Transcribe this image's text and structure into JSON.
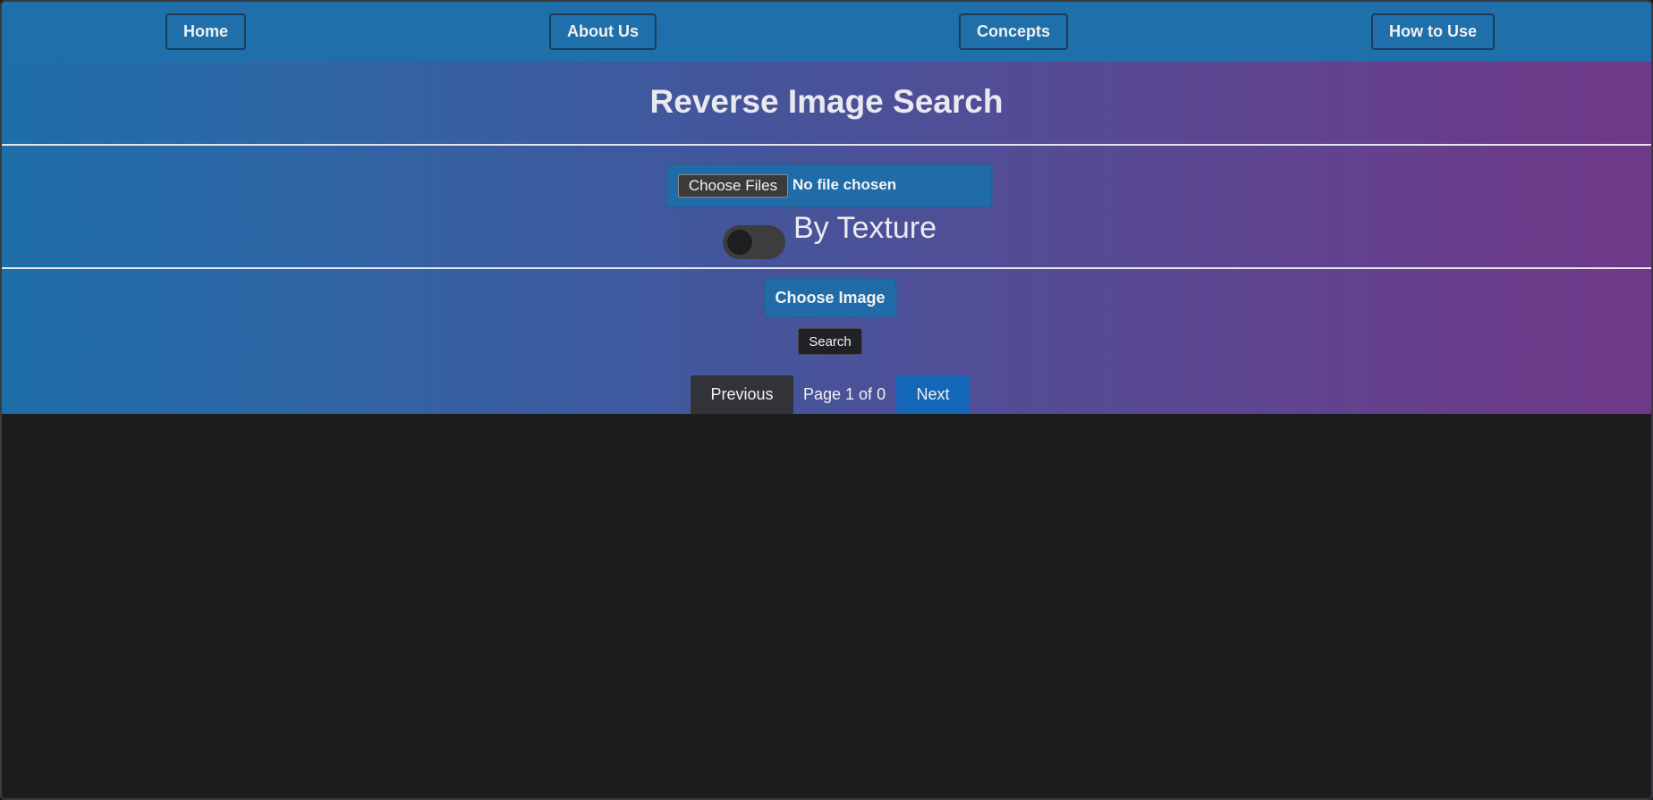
{
  "nav": {
    "items": [
      {
        "label": "Home"
      },
      {
        "label": "About Us"
      },
      {
        "label": "Concepts"
      },
      {
        "label": "How to Use"
      }
    ]
  },
  "hero": {
    "title": "Reverse Image Search"
  },
  "upload": {
    "file_button_label": "Choose Files",
    "file_status": "No file chosen"
  },
  "texture_toggle": {
    "label": "By Texture",
    "checked": false
  },
  "actions": {
    "choose_image_label": "Choose Image",
    "search_label": "Search"
  },
  "pagination": {
    "previous_label": "Previous",
    "page_info": "Page 1 of 0",
    "next_label": "Next"
  },
  "colors": {
    "nav_bg": "#1f70aa",
    "gradient_start": "#1e6ea9",
    "gradient_end": "#703888",
    "page_bg": "#1b1c1e",
    "next_button": "#1466b8",
    "previous_button": "#323338"
  },
  "icons": {
    "toggle": "toggle-switch-icon"
  }
}
